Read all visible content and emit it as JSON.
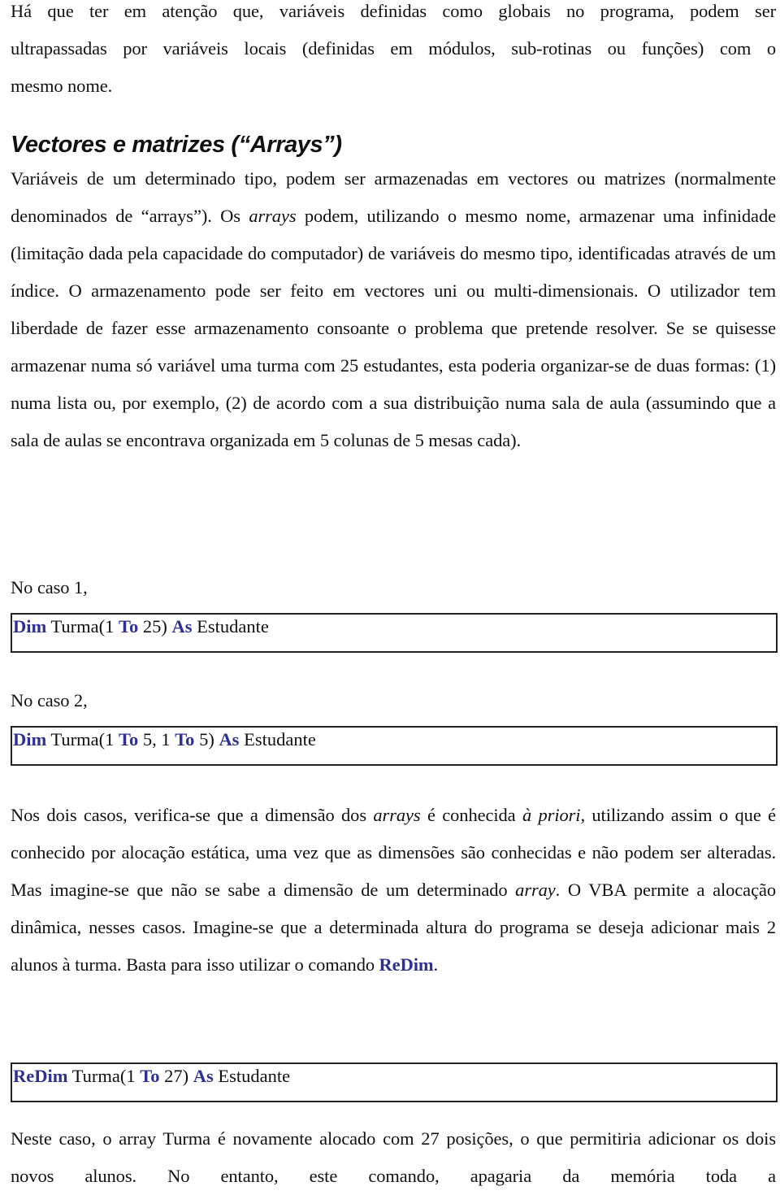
{
  "intro": {
    "lines": [
      "Há que ter em atenção que, variáveis definidas como globais no programa, podem ser",
      "ultrapassadas por variáveis locais (definidas em módulos, sub-rotinas ou funções) com o",
      "mesmo nome."
    ]
  },
  "section": {
    "heading": "Vectores e matrizes (“Arrays”)",
    "p1": {
      "t1": "Variáveis de um determinado tipo, podem ser armazenadas em vectores ou matrizes (normalmente denominados de “arrays”). Os ",
      "i1": "arrays",
      "t2": " podem, utilizando o mesmo nome, armazenar uma infinidade (limitação dada pela capacidade do computador) de variáveis do mesmo tipo, identificadas através de um índice. O armazenamento pode ser feito em vectores uni ou multi-dimensionais. O utilizador tem liberdade de fazer esse armazenamento consoante o problema que pretende resolver. Se se quisesse armazenar numa só variável uma turma com 25 estudantes, esta poderia organizar-se de duas formas: (1) numa lista ou, por exemplo, (2) de acordo com a sua distribuição numa sala de aula (assumindo que a sala de aulas se encontrava organizada em 5 colunas de 5 mesas cada)."
    }
  },
  "case1": {
    "label": "No caso 1,",
    "code": {
      "kw_dim": "Dim",
      "t1": " Turma(1 ",
      "kw_to": "To",
      "t2": " 25) ",
      "kw_as": "As",
      "t3": " Estudante"
    }
  },
  "case2": {
    "label": "No caso 2,",
    "code": {
      "kw_dim": "Dim",
      "t1": " Turma(1 ",
      "kw_to1": "To",
      "t2": " 5, 1 ",
      "kw_to2": "To",
      "t3": " 5) ",
      "kw_as": "As",
      "t4": " Estudante"
    }
  },
  "p2": {
    "t1": "Nos dois casos, verifica-se que a dimensão dos ",
    "i1": "arrays",
    "t2": " é conhecida ",
    "i2": "à priori",
    "t3": ", utilizando assim o que é conhecido por alocação estática, uma vez que as dimensões são conhecidas e não podem ser alteradas. Mas imagine-se que não se sabe a dimensão de um determinado ",
    "i3": "array",
    "t4": ". O VBA permite a alocação dinâmica, nesses casos. Imagine-se que a determinada altura do programa se deseja adicionar mais 2 alunos à turma. Basta para isso utilizar o comando ",
    "kw": "ReDim",
    "t5": "."
  },
  "case3": {
    "code": {
      "kw_redim": "ReDim",
      "t1": " Turma(1 ",
      "kw_to": "To",
      "t2": " 27) ",
      "kw_as": "As",
      "t3": " Estudante"
    }
  },
  "p3": {
    "text": "Neste caso, o array Turma é novamente alocado com 27 posições, o que permitiria adicionar os dois novos alunos. No entanto, este comando, apagaria da memória toda a"
  },
  "colors": {
    "keyword": "#2e3192",
    "text": "#111111",
    "border": "#222222"
  }
}
